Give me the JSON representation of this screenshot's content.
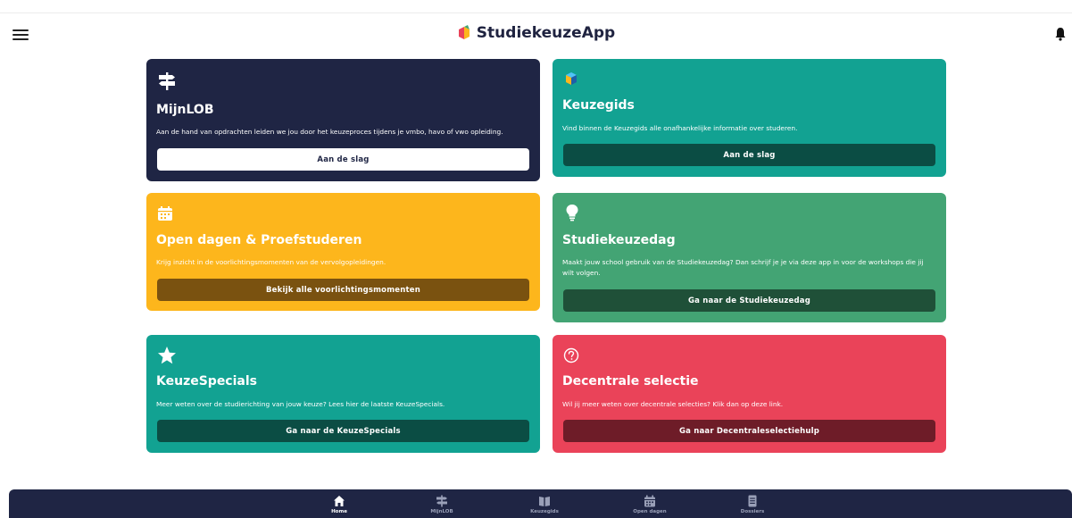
{
  "header": {
    "app_name": "StudiekeuzeApp"
  },
  "cards": {
    "mijnlob": {
      "title": "MijnLOB",
      "description": "Aan de hand van opdrachten leiden we jou door het keuzeproces tijdens je vmbo, havo of vwo opleiding.",
      "button": "Aan de slag",
      "icon": "signpost-icon"
    },
    "keuzegids": {
      "title": "Keuzegids",
      "description": "Vind binnen de Keuzegids alle onafhankelijke informatie over studeren.",
      "button": "Aan de slag",
      "icon": "keuzegids-logo-icon"
    },
    "open": {
      "title": "Open dagen & Proefstuderen",
      "description": "Krijg inzicht in de voorlichtingsmomenten van de vervolgopleidingen.",
      "button": "Bekijk alle voorlichtingsmomenten",
      "icon": "calendar-icon"
    },
    "studiekeuzedag": {
      "title": "Studiekeuzedag",
      "description": "Maakt jouw school gebruik van de Studiekeuzedag? Dan schrijf je je via deze app in voor de workshops die jij wilt volgen.",
      "button": "Ga naar de Studiekeuzedag",
      "icon": "lightbulb-icon"
    },
    "specials": {
      "title": "KeuzeSpecials",
      "description": "Meer weten over de studierichting van jouw keuze? Lees hier de laatste KeuzeSpecials.",
      "button": "Ga naar de KeuzeSpecials",
      "icon": "star-icon"
    },
    "decentraal": {
      "title": "Decentrale selectie",
      "description": "Wil jij meer weten over decentrale selecties? Klik dan op deze link.",
      "button": "Ga naar Decentraleselectiehulp",
      "icon": "question-circle-icon"
    }
  },
  "bottom_nav": [
    {
      "label": "Home",
      "icon": "home-icon",
      "active": true
    },
    {
      "label": "MijnLOB",
      "icon": "signpost-icon",
      "active": false
    },
    {
      "label": "Keuzegids",
      "icon": "book-icon",
      "active": false
    },
    {
      "label": "Open dagen",
      "icon": "calendar-icon",
      "active": false
    },
    {
      "label": "Dossiers",
      "icon": "document-icon",
      "active": false
    }
  ],
  "colors": {
    "navy": "#1f2544",
    "teal": "#12a292",
    "yellow": "#fdb61c",
    "green": "#43a474",
    "red": "#ea4359",
    "teal_button": "#0b4d44",
    "yellow_button": "#7a5210",
    "green_button": "#1f5038",
    "red_button": "#6e1c28"
  }
}
